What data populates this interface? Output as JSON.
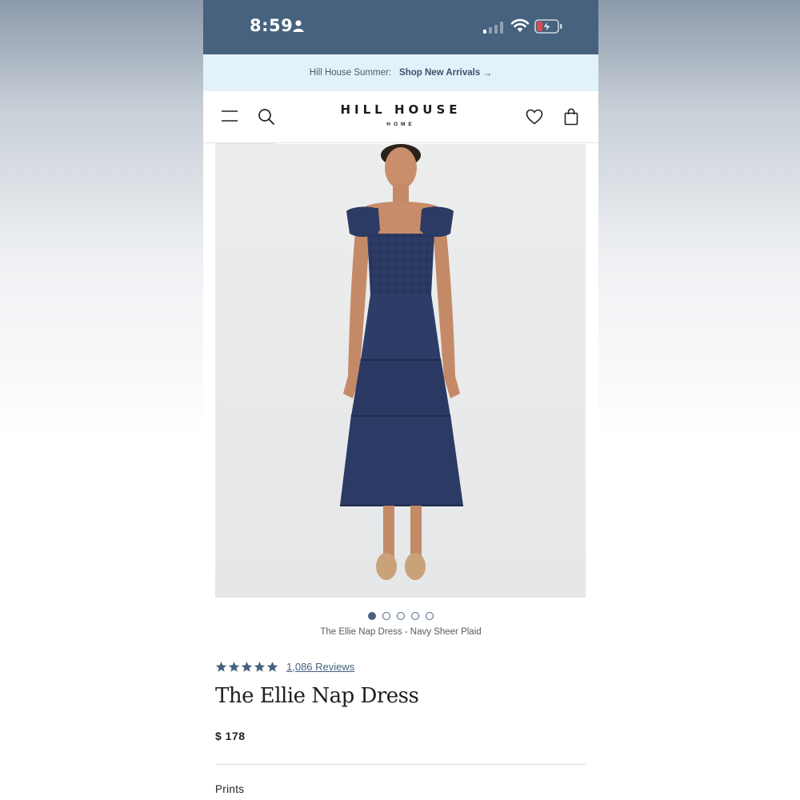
{
  "status_bar": {
    "time": "8:59"
  },
  "promo_banner": {
    "lead": "Hill House Summer:",
    "link": "Shop New Arrivals",
    "arrow": "→"
  },
  "header": {
    "logo_main": "HILL HOUSE",
    "logo_sub": "HOME"
  },
  "gallery": {
    "dots_total": 5,
    "active_index": 0,
    "caption": "The Ellie Nap Dress - Navy Sheer Plaid"
  },
  "product": {
    "rating": 5,
    "reviews_label": "1,086 Reviews",
    "title": "The Ellie Nap Dress",
    "price": "$ 178",
    "section_label": "Prints"
  },
  "colors": {
    "accent": "#46627e",
    "banner_bg": "#e3f1fb",
    "dress_navy": "#2b3a63"
  }
}
